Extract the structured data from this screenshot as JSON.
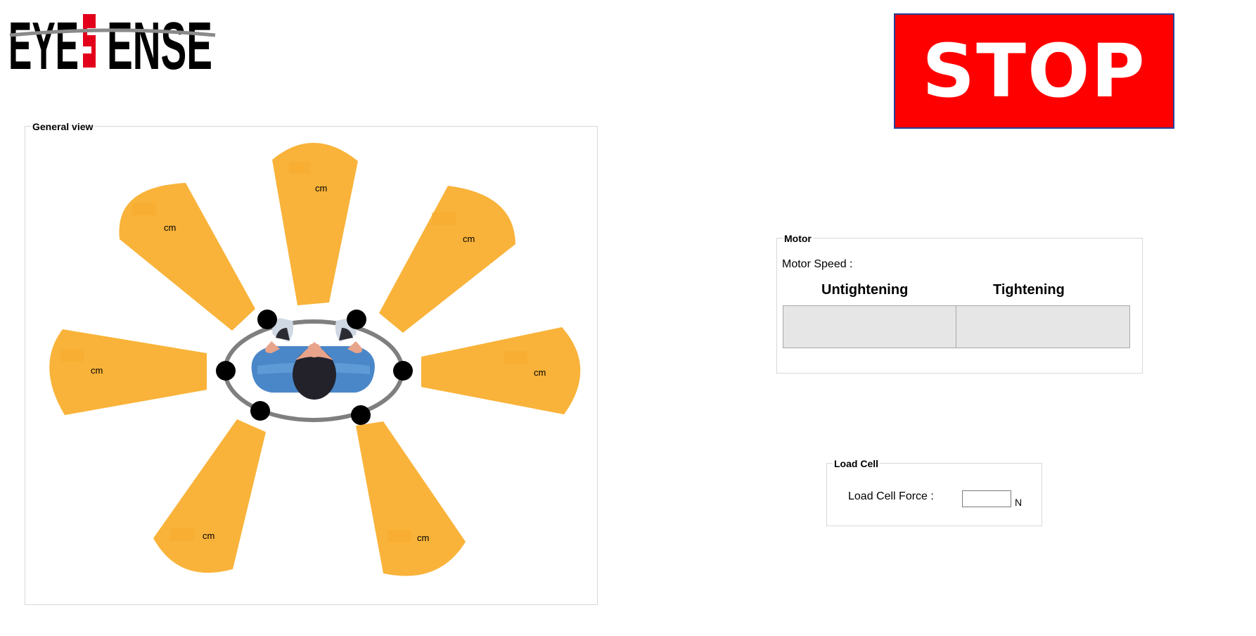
{
  "logo": {
    "text_left": "EYE",
    "text_right": "ENSE",
    "letter_mark": "S"
  },
  "stop_button": {
    "label": "STOP"
  },
  "general_view": {
    "title": "General view",
    "sensors": [
      {
        "id": "top",
        "unit": "cm"
      },
      {
        "id": "top-left",
        "unit": "cm"
      },
      {
        "id": "top-right",
        "unit": "cm"
      },
      {
        "id": "left",
        "unit": "cm"
      },
      {
        "id": "right",
        "unit": "cm"
      },
      {
        "id": "bottom-left",
        "unit": "cm"
      },
      {
        "id": "bottom-right",
        "unit": "cm"
      }
    ]
  },
  "motor": {
    "title": "Motor",
    "speed_label": "Motor Speed :",
    "col_untightening": "Untightening",
    "col_tightening": "Tightening"
  },
  "load_cell": {
    "title": "Load Cell",
    "force_label": "Load Cell Force :",
    "force_value": "",
    "unit": "N"
  },
  "colors": {
    "sensor_fill": "#f9b33a",
    "stop_red": "#ff0000",
    "logo_accent": "#e3001b",
    "shirt_blue": "#4a87c8"
  }
}
